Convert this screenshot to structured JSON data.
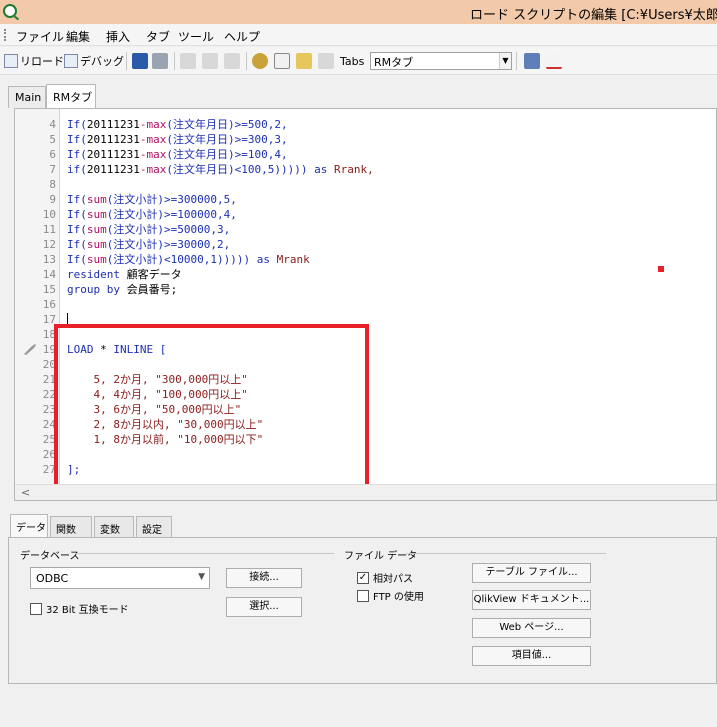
{
  "window": {
    "title": "ロード スクリプトの編集 [C:¥Users¥太郎"
  },
  "menu": [
    "ファイル",
    "編集",
    "挿入",
    "タブ",
    "ツール",
    "ヘルプ"
  ],
  "toolbar": {
    "reload_label": "リロード",
    "debug_label": "デバッグ",
    "tabs_label": "Tabs",
    "tab_select_value": "RMタブ"
  },
  "editor_tabs": [
    "Main",
    "RMタブ"
  ],
  "code_lines": [
    {
      "n": "4",
      "segments": [
        [
          "kw",
          "If("
        ],
        [
          "dk",
          "20111231"
        ],
        [
          "fn",
          "-max"
        ],
        [
          "kw",
          "("
        ],
        [
          "tx",
          "注文年月日"
        ],
        [
          "kw",
          ")>=500,2,"
        ]
      ]
    },
    {
      "n": "5",
      "segments": [
        [
          "kw",
          "If("
        ],
        [
          "dk",
          "20111231"
        ],
        [
          "fn",
          "-max"
        ],
        [
          "kw",
          "("
        ],
        [
          "tx",
          "注文年月日"
        ],
        [
          "kw",
          ")>=300,3,"
        ]
      ]
    },
    {
      "n": "6",
      "segments": [
        [
          "kw",
          "If("
        ],
        [
          "dk",
          "20111231"
        ],
        [
          "fn",
          "-max"
        ],
        [
          "kw",
          "("
        ],
        [
          "tx",
          "注文年月日"
        ],
        [
          "kw",
          ")>=100,4,"
        ]
      ]
    },
    {
      "n": "7",
      "segments": [
        [
          "kw",
          "if("
        ],
        [
          "dk",
          "20111231"
        ],
        [
          "fn",
          "-max"
        ],
        [
          "kw",
          "("
        ],
        [
          "tx",
          "注文年月日"
        ],
        [
          "kw",
          ")<100,5))))) "
        ],
        [
          "kw",
          "as "
        ],
        [
          "st",
          "Rrank,"
        ]
      ]
    },
    {
      "n": "8",
      "segments": []
    },
    {
      "n": "9",
      "segments": [
        [
          "kw",
          "If("
        ],
        [
          "fn",
          "sum"
        ],
        [
          "kw",
          "("
        ],
        [
          "tx",
          "注文小計"
        ],
        [
          "kw",
          ")>=300000,5,"
        ]
      ]
    },
    {
      "n": "10",
      "segments": [
        [
          "kw",
          "If("
        ],
        [
          "fn",
          "sum"
        ],
        [
          "kw",
          "("
        ],
        [
          "tx",
          "注文小計"
        ],
        [
          "kw",
          ")>=100000,4,"
        ]
      ]
    },
    {
      "n": "11",
      "segments": [
        [
          "kw",
          "If("
        ],
        [
          "fn",
          "sum"
        ],
        [
          "kw",
          "("
        ],
        [
          "tx",
          "注文小計"
        ],
        [
          "kw",
          ")>=50000,3,"
        ]
      ]
    },
    {
      "n": "12",
      "segments": [
        [
          "kw",
          "If("
        ],
        [
          "fn",
          "sum"
        ],
        [
          "kw",
          "("
        ],
        [
          "tx",
          "注文小計"
        ],
        [
          "kw",
          ")>=30000,2,"
        ]
      ]
    },
    {
      "n": "13",
      "segments": [
        [
          "kw",
          "If("
        ],
        [
          "fn",
          "sum"
        ],
        [
          "kw",
          "("
        ],
        [
          "tx",
          "注文小計"
        ],
        [
          "kw",
          ")<10000,1))))) "
        ],
        [
          "kw",
          "as "
        ],
        [
          "st",
          "Mrank"
        ]
      ]
    },
    {
      "n": "14",
      "segments": [
        [
          "kw",
          "resident "
        ],
        [
          "dk",
          "顧客データ"
        ]
      ]
    },
    {
      "n": "15",
      "segments": [
        [
          "kw",
          "group by "
        ],
        [
          "dk",
          "会員番号;"
        ]
      ]
    },
    {
      "n": "16",
      "segments": []
    },
    {
      "n": "17",
      "segments": []
    },
    {
      "n": "18",
      "segments": []
    },
    {
      "n": "19",
      "segments": [
        [
          "kw",
          "LOAD "
        ],
        [
          "dk",
          "* "
        ],
        [
          "kw",
          "INLINE ["
        ]
      ]
    },
    {
      "n": "20",
      "segments": []
    },
    {
      "n": "21",
      "segments": [
        [
          "st",
          "    5, 2か月, \"300,000円以上\""
        ]
      ]
    },
    {
      "n": "22",
      "segments": [
        [
          "st",
          "    4, 4か月, \"100,000円以上\""
        ]
      ]
    },
    {
      "n": "23",
      "segments": [
        [
          "st",
          "    3, 6か月, \"50,000円以上\""
        ]
      ]
    },
    {
      "n": "24",
      "segments": [
        [
          "st",
          "    2, 8か月以内, \"30,000円以上\""
        ]
      ]
    },
    {
      "n": "25",
      "segments": [
        [
          "st",
          "    1, 8か月以前, \"10,000円以下\""
        ]
      ]
    },
    {
      "n": "26",
      "segments": []
    },
    {
      "n": "27",
      "segments": [
        [
          "kw",
          "];"
        ]
      ]
    }
  ],
  "scroll_left_glyph": "<",
  "bottom_tabs": [
    "データ",
    "関数",
    "変数",
    "設定"
  ],
  "database": {
    "group_label": "データベース",
    "select_value": "ODBC",
    "connect_button": "接続...",
    "select_button": "選択...",
    "compat_checkbox_label": "32 Bit 互換モード",
    "compat_checked": false
  },
  "file_data": {
    "group_label": "ファイル データ",
    "relative_path_label": "相対パス",
    "relative_path_checked": true,
    "ftp_label": "FTP の使用",
    "ftp_checked": false,
    "table_file_button": "テーブル ファイル...",
    "qlikview_doc_button": "QlikView ドキュメント...",
    "web_page_button": "Web ページ...",
    "field_value_button": "項目値..."
  }
}
